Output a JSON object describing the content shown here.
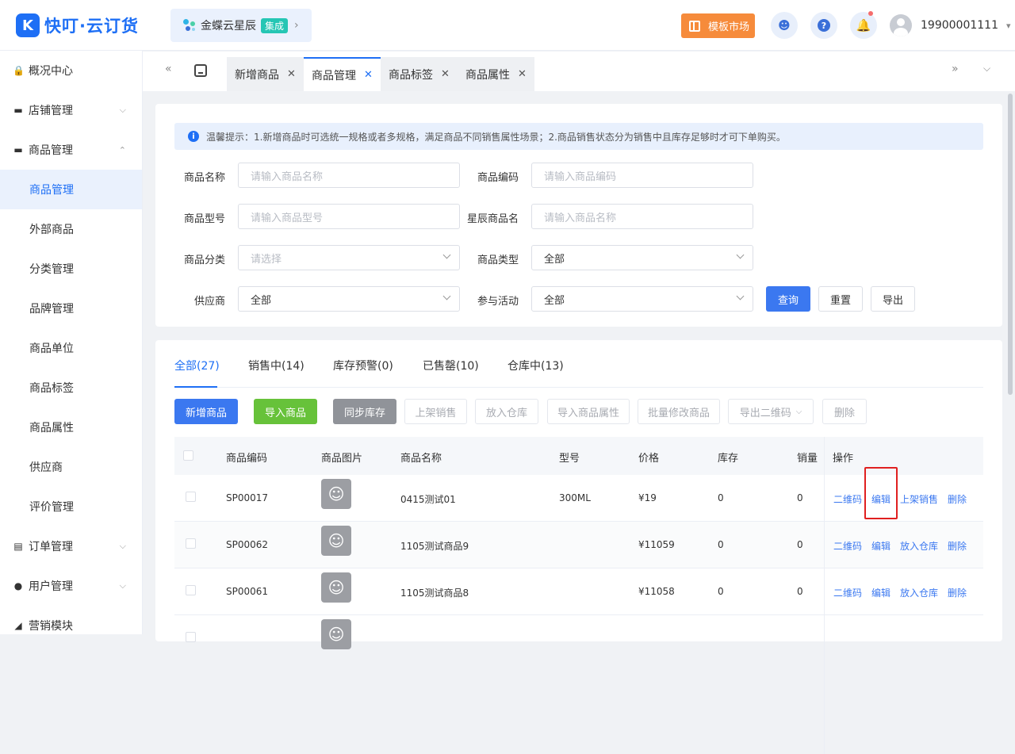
{
  "brand": {
    "name": "快叮·云订货",
    "logo_glyph": "K",
    "color": "#1e6ff5"
  },
  "integration": {
    "label": "金蝶云星辰",
    "tag": "集成",
    "arrow": "›"
  },
  "header": {
    "market_label": "模板市场",
    "user_name": "19900001111",
    "icons": [
      "service-icon",
      "help-icon",
      "bell-icon"
    ]
  },
  "sidebar": {
    "items": [
      {
        "label": "概况中心",
        "icon": "🔒"
      },
      {
        "label": "店铺管理",
        "icon": "▬",
        "arrow": "⌵"
      },
      {
        "label": "商品管理",
        "icon": "▬",
        "arrow": "⌃"
      },
      {
        "label": "商品管理"
      },
      {
        "label": "外部商品"
      },
      {
        "label": "分类管理"
      },
      {
        "label": "品牌管理"
      },
      {
        "label": "商品单位"
      },
      {
        "label": "商品标签"
      },
      {
        "label": "商品属性"
      },
      {
        "label": "供应商"
      },
      {
        "label": "评价管理"
      },
      {
        "label": "订单管理",
        "icon": "▤",
        "arrow": "⌵"
      },
      {
        "label": "用户管理",
        "icon": "●",
        "arrow": "⌵"
      },
      {
        "label": "营销模块",
        "icon": "◢"
      }
    ]
  },
  "tabs": [
    {
      "label": "新增商品",
      "close": "✕"
    },
    {
      "label": "商品管理",
      "close": "✕"
    },
    {
      "label": "商品标签",
      "close": "✕"
    },
    {
      "label": "商品属性",
      "close": "✕"
    }
  ],
  "tip": {
    "icon": "i",
    "text": "温馨提示：1.新增商品时可选统一规格或者多规格，满足商品不同销售属性场景；2.商品销售状态分为销售中且库存足够时才可下单购买。"
  },
  "filters": {
    "name_label": "商品名称",
    "name_placeholder": "请输入商品名称",
    "code_label": "商品编码",
    "code_placeholder": "请输入商品编码",
    "model_label": "商品型号",
    "model_placeholder": "请输入商品型号",
    "xc_label": "星辰商品名",
    "xc_placeholder": "请输入商品名称",
    "category_label": "商品分类",
    "category_placeholder": "请选择",
    "type_label": "商品类型",
    "type_value": "全部",
    "supplier_label": "供应商",
    "supplier_value": "全部",
    "activity_label": "参与活动",
    "activity_value": "全部",
    "query": "查询",
    "reset": "重置",
    "export": "导出"
  },
  "status_tabs": [
    "全部(27)",
    "销售中(14)",
    "库存预警(0)",
    "已售罄(10)",
    "仓库中(13)"
  ],
  "actions": {
    "add": "新增商品",
    "import": "导入商品",
    "sync": "同步库存",
    "on_sale": "上架销售",
    "to_warehouse": "放入仓库",
    "import_attr": "导入商品属性",
    "batch_edit": "批量修改商品",
    "export_qr": "导出二维码",
    "delete": "删除"
  },
  "table": {
    "columns": [
      "商品编码",
      "商品图片",
      "商品名称",
      "型号",
      "价格",
      "库存",
      "销量",
      "操作"
    ],
    "rows": [
      {
        "code": "SP00017",
        "name": "0415测试01",
        "model": "300ML",
        "price": "¥19",
        "stock": "0",
        "sales": "0",
        "ops": [
          "二维码",
          "编辑",
          "上架销售",
          "删除"
        ]
      },
      {
        "code": "SP00062",
        "name": "1105测试商品9",
        "model": "",
        "price": "¥11059",
        "stock": "0",
        "sales": "0",
        "ops": [
          "二维码",
          "编辑",
          "放入仓库",
          "删除"
        ]
      },
      {
        "code": "SP00061",
        "name": "1105测试商品8",
        "model": "",
        "price": "¥11058",
        "stock": "0",
        "sales": "0",
        "ops": [
          "二维码",
          "编辑",
          "放入仓库",
          "删除"
        ]
      }
    ]
  }
}
